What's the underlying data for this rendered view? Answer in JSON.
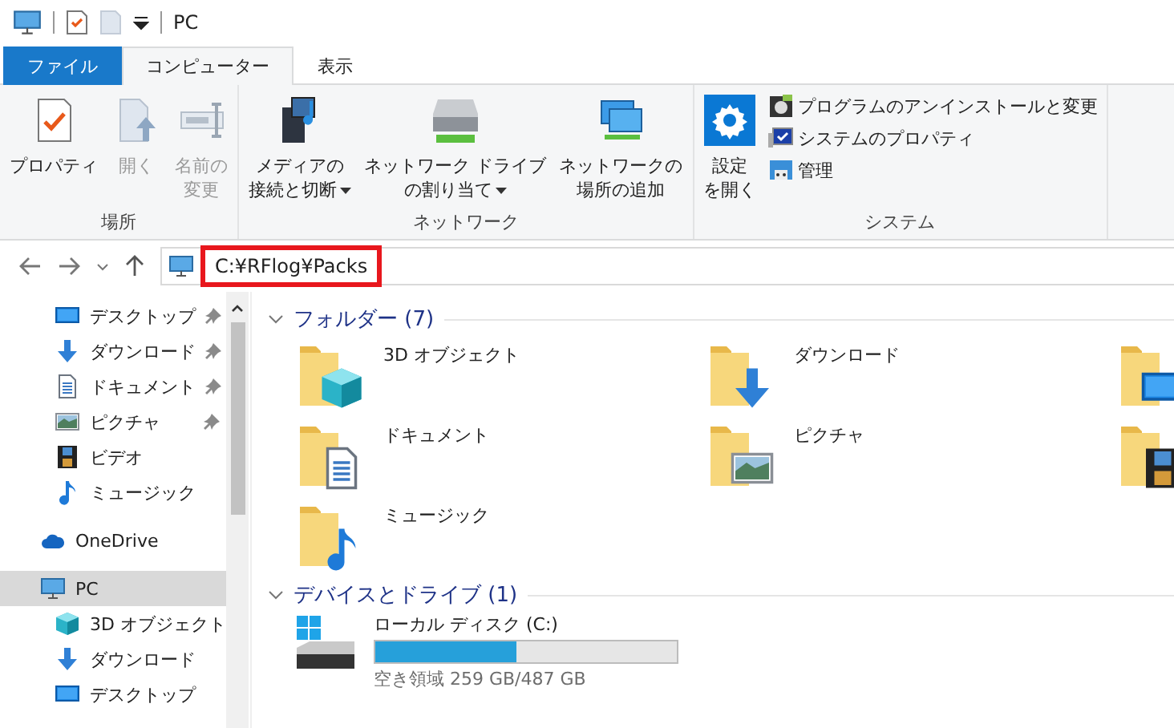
{
  "title_bar": {
    "title": "PC"
  },
  "ribbon": {
    "tabs": [
      {
        "label": "ファイル",
        "kind": "file",
        "selected": false
      },
      {
        "label": "コンピューター",
        "kind": "tab",
        "selected": true
      },
      {
        "label": "表示",
        "kind": "tab",
        "selected": false
      }
    ],
    "groups": [
      {
        "name": "場所",
        "buttons": [
          {
            "kind": "properties",
            "lines": [
              "プロパティ"
            ],
            "disabled": false,
            "dropdown": false
          },
          {
            "kind": "open",
            "lines": [
              "開く"
            ],
            "disabled": true,
            "dropdown": false
          },
          {
            "kind": "rename",
            "lines": [
              "名前の",
              "変更"
            ],
            "disabled": true,
            "dropdown": false
          }
        ]
      },
      {
        "name": "ネットワーク",
        "buttons": [
          {
            "kind": "media",
            "lines": [
              "メディアの",
              "接続と切断"
            ],
            "disabled": false,
            "dropdown": true
          },
          {
            "kind": "network-drive",
            "lines": [
              "ネットワーク ドライブ",
              "の割り当て"
            ],
            "disabled": false,
            "dropdown": true
          },
          {
            "kind": "network-location",
            "lines": [
              "ネットワークの",
              "場所の追加"
            ],
            "disabled": false,
            "dropdown": false
          }
        ]
      },
      {
        "name": "システム",
        "buttons": [
          {
            "kind": "settings",
            "lines": [
              "設定",
              "を開く"
            ],
            "disabled": false,
            "dropdown": false
          }
        ],
        "small_buttons": [
          {
            "kind": "uninstall",
            "label": "プログラムのアンインストールと変更"
          },
          {
            "kind": "system-properties",
            "label": "システムのプロパティ"
          },
          {
            "kind": "manage",
            "label": "管理"
          }
        ]
      }
    ]
  },
  "address_bar": {
    "path": "C:¥RFlog¥Packs",
    "highlighted": true
  },
  "sidebar": {
    "quick_access": [
      {
        "kind": "desktop",
        "label": "デスクトップ",
        "pinned": true,
        "selected": false
      },
      {
        "kind": "download",
        "label": "ダウンロード",
        "pinned": true,
        "selected": false
      },
      {
        "kind": "document",
        "label": "ドキュメント",
        "pinned": true,
        "selected": false
      },
      {
        "kind": "picture",
        "label": "ピクチャ",
        "pinned": true,
        "selected": false
      },
      {
        "kind": "video",
        "label": "ビデオ",
        "pinned": false,
        "selected": false
      },
      {
        "kind": "music",
        "label": "ミュージック",
        "pinned": false,
        "selected": false
      }
    ],
    "locations": [
      {
        "kind": "cloud",
        "label": "OneDrive",
        "selected": false
      },
      {
        "kind": "pc",
        "label": "PC",
        "selected": true,
        "children": [
          {
            "kind": "cube",
            "label": "3D オブジェクト",
            "selected": false
          },
          {
            "kind": "download",
            "label": "ダウンロード",
            "selected": false
          },
          {
            "kind": "desktop",
            "label": "デスクトップ",
            "selected": false
          }
        ]
      }
    ]
  },
  "content": {
    "sections": [
      {
        "kind": "folders",
        "title": "フォルダー (7)",
        "expanded": true,
        "items": [
          {
            "kind": "cube",
            "name": "3D オブジェクト"
          },
          {
            "kind": "download",
            "name": "ダウンロード"
          },
          {
            "kind": "desktop"
          },
          {
            "kind": "document",
            "name": "ドキュメント"
          },
          {
            "kind": "picture",
            "name": "ピクチャ"
          },
          {
            "kind": "video"
          },
          {
            "kind": "music",
            "name": "ミュージック"
          }
        ]
      },
      {
        "kind": "drives",
        "title": "デバイスとドライブ (1)",
        "expanded": true,
        "items": [
          {
            "name": "ローカル ディスク (C:)",
            "level": 0.47,
            "free": "空き領域 259 GB/487 GB"
          }
        ]
      }
    ]
  }
}
